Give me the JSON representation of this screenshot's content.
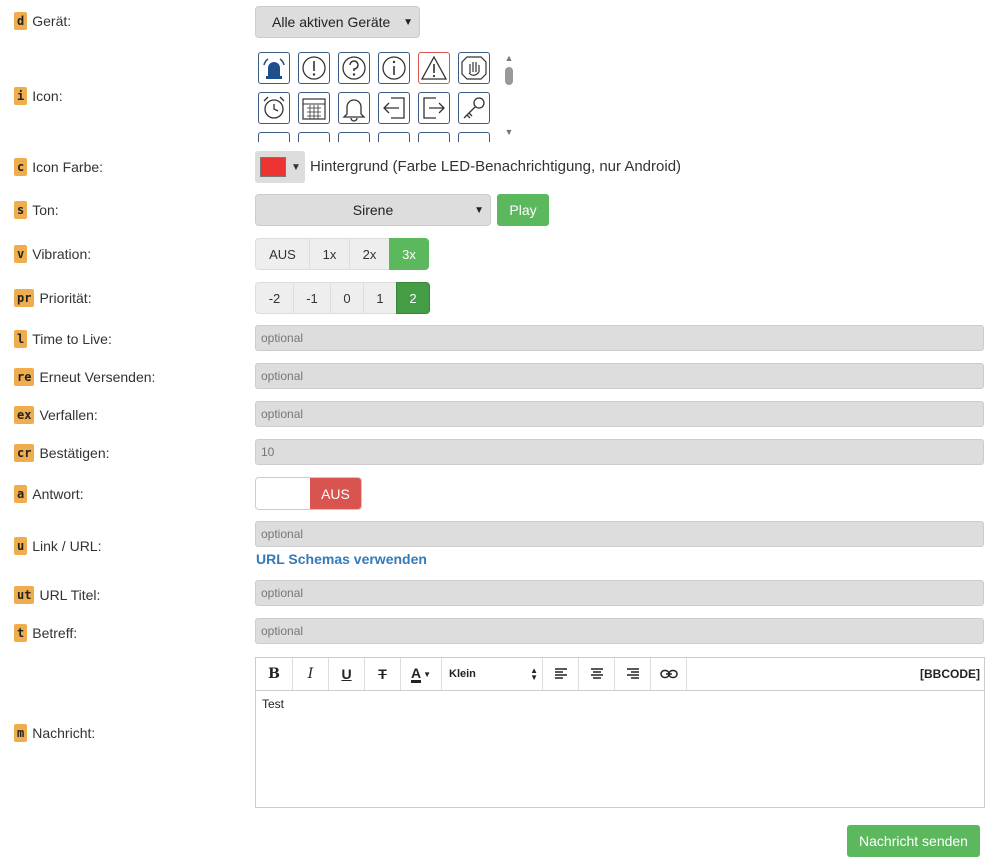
{
  "geraet": {
    "key": "d",
    "label": "Gerät:",
    "value": "Alle aktiven Geräte"
  },
  "icon": {
    "key": "i",
    "label": "Icon:"
  },
  "icon_farbe": {
    "key": "c",
    "label": "Icon Farbe:",
    "swatch_color": "#ee3333",
    "hint": "Hintergrund (Farbe LED-Benachrichtigung, nur Android)"
  },
  "ton": {
    "key": "s",
    "label": "Ton:",
    "value": "Sirene",
    "play_label": "Play"
  },
  "vibration": {
    "key": "v",
    "label": "Vibration:",
    "options": [
      "AUS",
      "1x",
      "2x",
      "3x"
    ],
    "selected": "3x"
  },
  "prioritaet": {
    "key": "pr",
    "label": "Priorität:",
    "options": [
      "-2",
      "-1",
      "0",
      "1",
      "2"
    ],
    "selected": "2"
  },
  "ttl": {
    "key": "l",
    "label": "Time to Live:",
    "placeholder": "optional"
  },
  "erneut": {
    "key": "re",
    "label": "Erneut Versenden:",
    "placeholder": "optional"
  },
  "verfallen": {
    "key": "ex",
    "label": "Verfallen:",
    "placeholder": "optional"
  },
  "bestaetigen": {
    "key": "cr",
    "label": "Bestätigen:",
    "value": "10"
  },
  "antwort": {
    "key": "a",
    "label": "Antwort:",
    "toggle_label": "AUS"
  },
  "link": {
    "key": "u",
    "label": "Link / URL:",
    "placeholder": "optional",
    "schema_link": "URL Schemas verwenden"
  },
  "url_titel": {
    "key": "ut",
    "label": "URL Titel:",
    "placeholder": "optional"
  },
  "betreff": {
    "key": "t",
    "label": "Betreff:",
    "placeholder": "optional"
  },
  "nachricht": {
    "key": "m",
    "label": "Nachricht:",
    "text": "Test",
    "font_size": "Klein",
    "bbcode_label": "[BBCODE]"
  },
  "toolbar": {
    "bold": "B",
    "italic": "I",
    "underline": "U",
    "strike": "T",
    "color": "A"
  },
  "send_label": "Nachricht senden",
  "icons": [
    "siren-icon",
    "exclamation-icon",
    "question-icon",
    "info-icon",
    "warning-icon",
    "hand-stop-icon",
    "alarm-clock-icon",
    "calendar-icon",
    "bell-icon",
    "sign-in-icon",
    "sign-out-icon",
    "key-icon"
  ]
}
